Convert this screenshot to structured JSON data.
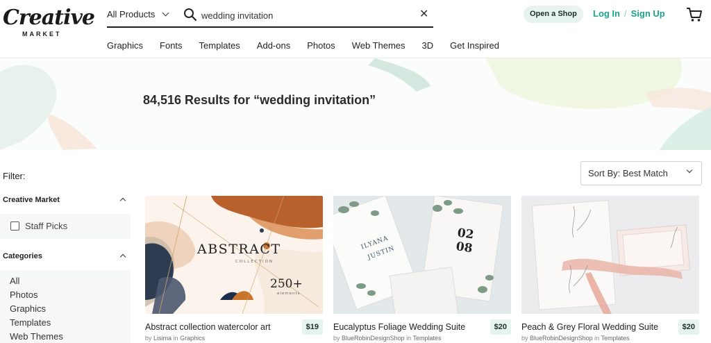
{
  "brand": {
    "logo_main": "Creative",
    "logo_sub": "MARKET"
  },
  "search": {
    "category": "All Products",
    "query": "wedding invitation",
    "placeholder": "Search"
  },
  "header": {
    "open_shop": "Open a Shop",
    "login": "Log In",
    "separator": "/",
    "signup": "Sign Up"
  },
  "nav": [
    "Graphics",
    "Fonts",
    "Templates",
    "Add-ons",
    "Photos",
    "Web Themes",
    "3D",
    "Get Inspired"
  ],
  "hero": {
    "results": "84,516 Results for “wedding invitation”"
  },
  "filters": {
    "label": "Filter:",
    "creative_market": {
      "heading": "Creative Market",
      "staff_picks": "Staff Picks"
    },
    "categories": {
      "heading": "Categories",
      "items": [
        "All",
        "Photos",
        "Graphics",
        "Templates",
        "Web Themes"
      ]
    }
  },
  "sort": {
    "label": "Sort By: Best Match"
  },
  "products": [
    {
      "title": "Abstract collection watercolor art",
      "price": "$19",
      "by": "by",
      "shop": "Lisima",
      "in": "in",
      "category": "Graphics",
      "img_text_1": "ABSTRACT",
      "img_text_2": "COLLECTION",
      "img_text_3": "250+",
      "img_text_4": "elements"
    },
    {
      "title": "Eucalyptus Foliage Wedding Suite",
      "price": "$20",
      "by": "by",
      "shop": "BlueRobinDesignShop",
      "in": "in",
      "category": "Templates",
      "img_text_1": "ILYANA",
      "img_text_2": "JUSTIN",
      "img_text_3": "02",
      "img_text_4": "08"
    },
    {
      "title": "Peach & Grey Floral Wedding Suite",
      "price": "$20",
      "by": "by",
      "shop": "BlueRobinDesignShop",
      "in": "in",
      "category": "Templates"
    }
  ],
  "colors": {
    "accent": "#1aa389",
    "badge_bg": "#e6f3ee"
  }
}
